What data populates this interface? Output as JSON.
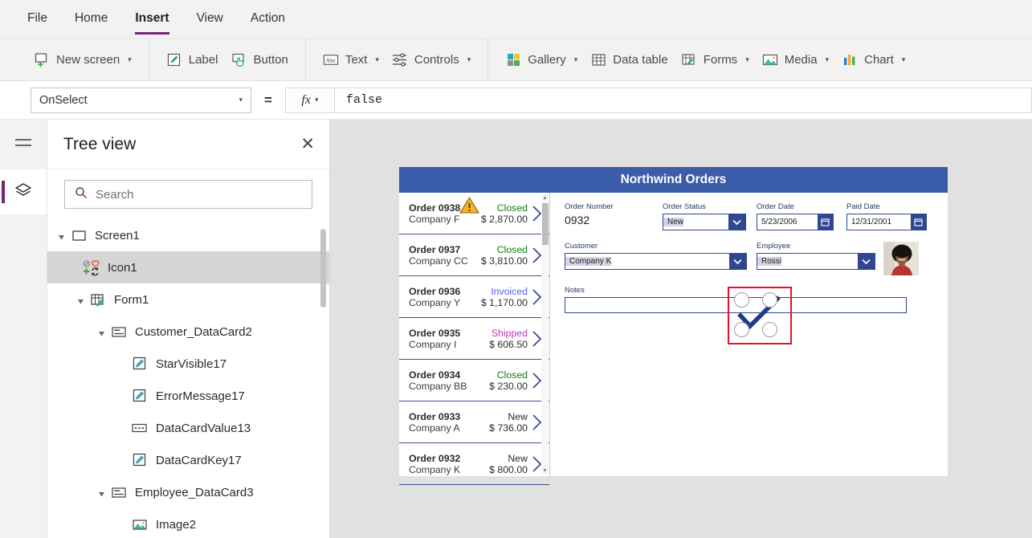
{
  "menu": {
    "items": [
      {
        "label": "File",
        "active": false
      },
      {
        "label": "Home",
        "active": false
      },
      {
        "label": "Insert",
        "active": true
      },
      {
        "label": "View",
        "active": false
      },
      {
        "label": "Action",
        "active": false
      }
    ]
  },
  "ribbon": {
    "groups": [
      {
        "items": [
          {
            "label": "New screen",
            "icon": "new-screen-icon",
            "caret": true
          }
        ]
      },
      {
        "items": [
          {
            "label": "Label",
            "icon": "label-icon",
            "caret": false
          },
          {
            "label": "Button",
            "icon": "button-icon",
            "caret": false
          }
        ]
      },
      {
        "items": [
          {
            "label": "Text",
            "icon": "text-icon",
            "caret": true
          },
          {
            "label": "Controls",
            "icon": "controls-icon",
            "caret": true
          }
        ]
      },
      {
        "items": [
          {
            "label": "Gallery",
            "icon": "gallery-icon",
            "caret": true
          },
          {
            "label": "Data table",
            "icon": "data-table-icon",
            "caret": false
          },
          {
            "label": "Forms",
            "icon": "forms-icon",
            "caret": true
          },
          {
            "label": "Media",
            "icon": "media-icon",
            "caret": true
          },
          {
            "label": "Chart",
            "icon": "chart-icon",
            "caret": true
          }
        ]
      }
    ]
  },
  "formula_bar": {
    "property": "OnSelect",
    "equals": "=",
    "fx_label": "fx",
    "formula": "false"
  },
  "rail": {
    "hamburger": "hamburger-icon",
    "active_tab": "tree-view-layers-icon"
  },
  "tree_panel": {
    "title": "Tree view",
    "close_label": "✕",
    "search": {
      "placeholder": "Search",
      "value": "",
      "icon": "search-icon"
    },
    "nodes": [
      {
        "label": "Screen1",
        "indent": 0,
        "arrow": true,
        "icon": "screen-icon",
        "selected": false
      },
      {
        "label": "Icon1",
        "indent": 1,
        "arrow": false,
        "icon": "icon-control-icon",
        "selected": true
      },
      {
        "label": "Form1",
        "indent": 1,
        "arrow": true,
        "icon": "form-icon",
        "selected": false
      },
      {
        "label": "Customer_DataCard2",
        "indent": 2,
        "arrow": true,
        "icon": "datacard-icon",
        "selected": false
      },
      {
        "label": "StarVisible17",
        "indent": 3,
        "arrow": false,
        "icon": "label-edit-icon",
        "selected": false
      },
      {
        "label": "ErrorMessage17",
        "indent": 3,
        "arrow": false,
        "icon": "label-edit-icon",
        "selected": false
      },
      {
        "label": "DataCardValue13",
        "indent": 3,
        "arrow": false,
        "icon": "dropdown-value-icon",
        "selected": false
      },
      {
        "label": "DataCardKey17",
        "indent": 3,
        "arrow": false,
        "icon": "label-edit-icon",
        "selected": false
      },
      {
        "label": "Employee_DataCard3",
        "indent": 2,
        "arrow": true,
        "icon": "datacard-icon",
        "selected": false
      },
      {
        "label": "Image2",
        "indent": 3,
        "arrow": false,
        "icon": "image-icon",
        "selected": false
      }
    ]
  },
  "app": {
    "title": "Northwind Orders",
    "gallery": {
      "rows": [
        {
          "order": "Order 0938",
          "customer": "Company F",
          "status": "Closed",
          "amount": "$ 2,870.00",
          "status_color": "#107c10",
          "warning": true
        },
        {
          "order": "Order 0937",
          "customer": "Company CC",
          "status": "Closed",
          "amount": "$ 3,810.00",
          "status_color": "#107c10",
          "warning": false
        },
        {
          "order": "Order 0936",
          "customer": "Company Y",
          "status": "Invoiced",
          "amount": "$ 1,170.00",
          "status_color": "#5a5aff",
          "warning": false
        },
        {
          "order": "Order 0935",
          "customer": "Company I",
          "status": "Shipped",
          "amount": "$ 606.50",
          "status_color": "#c239b3",
          "warning": false
        },
        {
          "order": "Order 0934",
          "customer": "Company BB",
          "status": "Closed",
          "amount": "$ 230.00",
          "status_color": "#107c10",
          "warning": false
        },
        {
          "order": "Order 0933",
          "customer": "Company A",
          "status": "New",
          "amount": "$ 736.00",
          "status_color": "#2b2b2b",
          "warning": false
        },
        {
          "order": "Order 0932",
          "customer": "Company K",
          "status": "New",
          "amount": "$ 800.00",
          "status_color": "#2b2b2b",
          "warning": false
        }
      ]
    },
    "form": {
      "order_number": {
        "label": "Order Number",
        "value": "0932"
      },
      "order_status": {
        "label": "Order Status",
        "value": "New"
      },
      "order_date": {
        "label": "Order Date",
        "value": "5/23/2006"
      },
      "paid_date": {
        "label": "Paid Date",
        "value": "12/31/2001"
      },
      "customer": {
        "label": "Customer",
        "value": "Company K"
      },
      "employee": {
        "label": "Employee",
        "value": "Rossi"
      },
      "notes": {
        "label": "Notes",
        "value": ""
      },
      "avatar_name": "employee-photo"
    }
  },
  "selection": {
    "control": "Icon1",
    "icon": "check-icon",
    "border_color": "#e81123"
  }
}
